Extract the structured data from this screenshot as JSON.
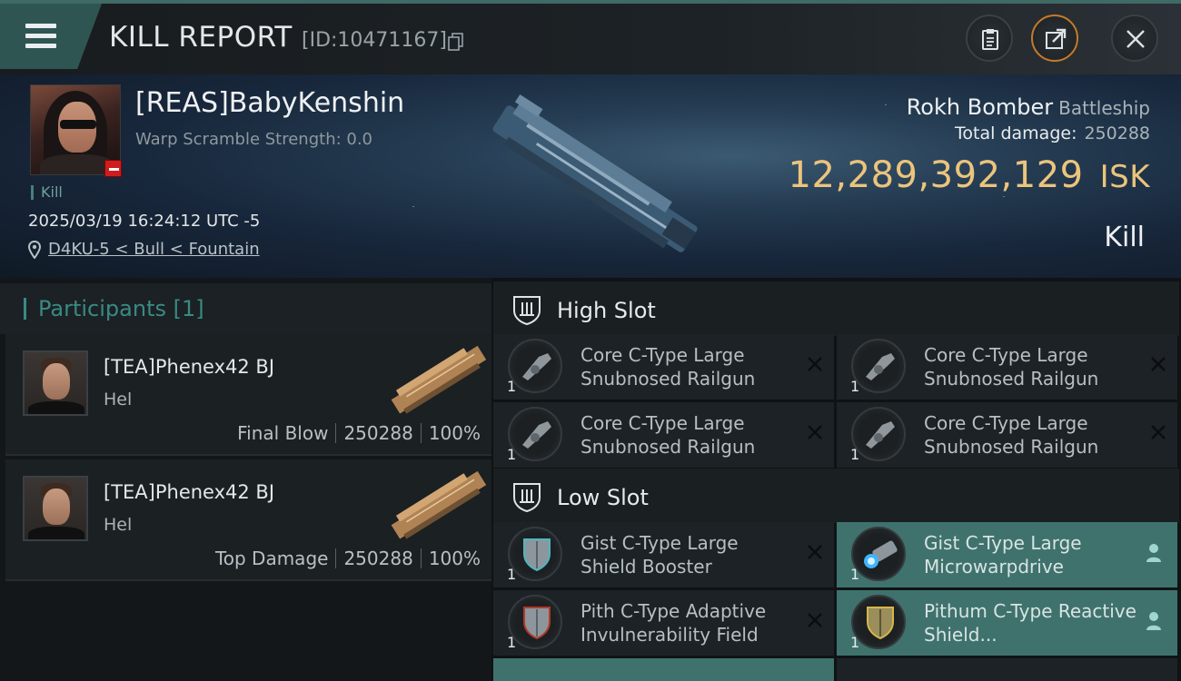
{
  "header": {
    "title": "KILL REPORT",
    "report_id": "[ID:10471167]"
  },
  "victim": {
    "name": "[REAS]BabyKenshin",
    "warp_scramble": "Warp Scramble Strength: 0.0",
    "kill_tag": "Kill",
    "timestamp": "2025/03/19 16:24:12 UTC -5",
    "location": "D4KU-5 < Bull < Fountain",
    "ship_name": "Rokh Bomber",
    "ship_class": "Battleship",
    "total_damage_label": "Total damage:",
    "total_damage": "250288",
    "isk_value": "12,289,392,129",
    "isk_unit": "ISK",
    "result": "Kill"
  },
  "participants": {
    "title": "Participants [1]",
    "items": [
      {
        "name": "[TEA]Phenex42 BJ",
        "ship": "Hel",
        "role": "Final Blow",
        "damage": "250288",
        "percent": "100%"
      },
      {
        "name": "[TEA]Phenex42 BJ",
        "ship": "Hel",
        "role": "Top Damage",
        "damage": "250288",
        "percent": "100%"
      }
    ]
  },
  "fitting": {
    "high_slot": {
      "label": "High Slot",
      "modules": [
        {
          "qty": "1",
          "name": "Core C-Type Large Snubnosed Railgun",
          "state": "destroyed"
        },
        {
          "qty": "1",
          "name": "Core C-Type Large Snubnosed Railgun",
          "state": "destroyed"
        },
        {
          "qty": "1",
          "name": "Core C-Type Large Snubnosed Railgun",
          "state": "destroyed"
        },
        {
          "qty": "1",
          "name": "Core C-Type Large Snubnosed Railgun",
          "state": "destroyed"
        }
      ]
    },
    "low_slot": {
      "label": "Low Slot",
      "modules": [
        {
          "qty": "1",
          "name": "Gist C-Type Large Shield Booster",
          "state": "destroyed"
        },
        {
          "qty": "1",
          "name": "Gist C-Type Large Microwarpdrive",
          "state": "dropped"
        },
        {
          "qty": "1",
          "name": "Pith C-Type Adaptive Invulnerability Field",
          "state": "destroyed"
        },
        {
          "qty": "1",
          "name": "Pithum C-Type Reactive Shield...",
          "state": "dropped"
        }
      ]
    }
  },
  "colors": {
    "accent_teal": "#3f726d",
    "isk_gold": "#ecc47c",
    "warning_red": "#d01c1c"
  }
}
